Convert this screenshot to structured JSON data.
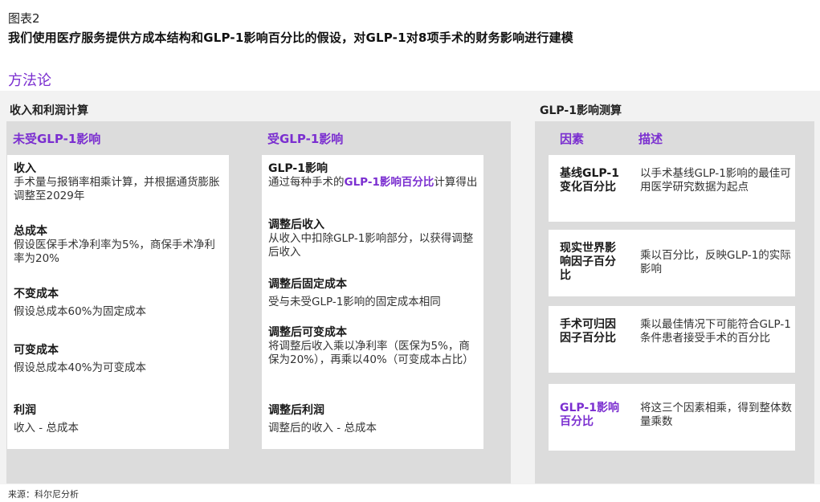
{
  "figure_label": "图表2",
  "headline": "我们使用医疗服务提供方成本结构和GLP-1影响百分比的假设，对GLP-1对8项手术的财务影响进行建模",
  "method_title": "方法论",
  "left_section": {
    "title": "收入和利润计算",
    "unaffected": {
      "header": "未受GLP-1影响",
      "items": [
        {
          "title": "收入",
          "text": "手术量与报销率相乘计算，并根据通货膨胀调整至2029年"
        },
        {
          "title": "总成本",
          "text": "假设医保手术净利率为5%，商保手术净利率为20%"
        },
        {
          "title": "不变成本",
          "text": "假设总成本60%为固定成本"
        },
        {
          "title": "可变成本",
          "text": "假设总成本40%为可变成本"
        },
        {
          "title": "利润",
          "text": "收入 - 总成本"
        }
      ]
    },
    "affected": {
      "header": "受GLP-1影响",
      "items": [
        {
          "title": "GLP-1影响",
          "text_pre": "通过每种手术的",
          "text_highlight": "GLP-1影响百分比",
          "text_post": "计算得出"
        },
        {
          "title": "调整后收入",
          "text": "从收入中扣除GLP-1影响部分，以获得调整后收入"
        },
        {
          "title": "调整后固定成本",
          "text": "受与未受GLP-1影响的固定成本相同"
        },
        {
          "title": "调整后可变成本",
          "text": "将调整后收入乘以净利率（医保为5%，商保为20%），再乘以40%（可变成本占比）"
        },
        {
          "title": "调整后利润",
          "text": "调整后的收入 - 总成本"
        }
      ]
    }
  },
  "right_section": {
    "title": "GLP-1影响测算",
    "col_factor": "因素",
    "col_desc": "描述",
    "rows": [
      {
        "factor": "基线GLP-1变化百分比",
        "desc": "以手术基线GLP-1影响的最佳可用医学研究数据为起点",
        "highlight": false
      },
      {
        "factor": "现实世界影响因子百分比",
        "desc": "乘以百分比，反映GLP-1的实际影响",
        "highlight": false
      },
      {
        "factor": "手术可归因因子百分比",
        "desc": "乘以最佳情况下可能符合GLP-1条件患者接受手术的百分比",
        "highlight": false
      },
      {
        "factor": "GLP-1影响百分比",
        "desc": "将这三个因素相乘，得到整体数量乘数",
        "highlight": true
      }
    ]
  },
  "source": "来源：科尔尼分析",
  "colors": {
    "accent": "#7B2FD0",
    "panel": "#dcdcdc",
    "band": "#f2f2f2",
    "card": "#ffffff"
  }
}
